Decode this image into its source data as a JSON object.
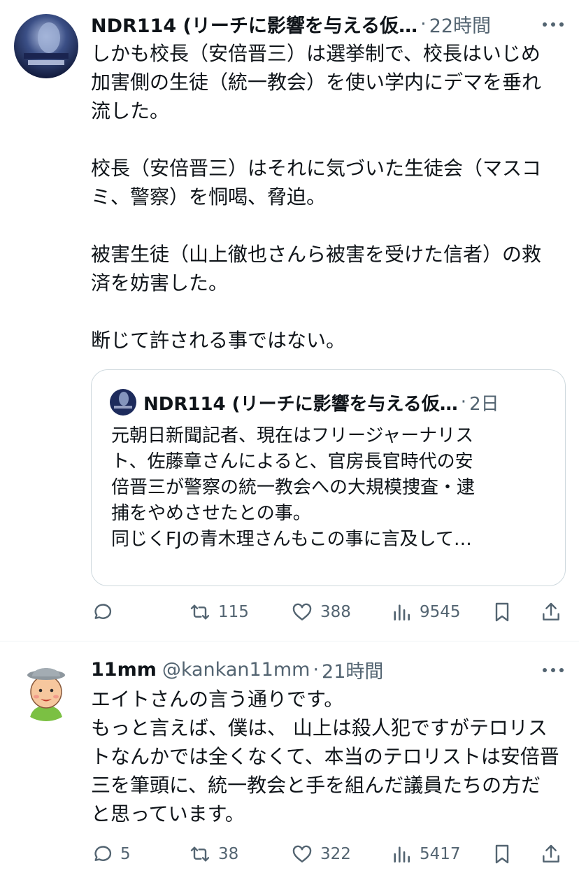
{
  "tweets": [
    {
      "name": "NDR114 (リーチに影響を与える仮…",
      "handle": "",
      "time": "22時間",
      "body": [
        "しかも校長（安倍晋三）は選挙制で、校長はいじめ加害側の生徒（統一教会）を使い学内にデマを垂れ流した。",
        "",
        "校長（安倍晋三）はそれに気づいた生徒会（マスコミ、警察）を恫喝、脅迫。",
        "",
        "被害生徒（山上徹也さんら被害を受けた信者）の救済を妨害した。",
        "",
        "断じて許される事ではない。"
      ],
      "quote": {
        "name": "NDR114 (リーチに影響を与える仮…",
        "time": "2日",
        "lines": [
          "元朝日新聞記者、現在はフリージャーナリス",
          "ト、佐藤章さんによると、官房長官時代の安",
          "倍晋三が警察の統一教会への大規模捜査・逮",
          "捕をやめさせたとの事。",
          "同じくFJの青木理さんもこの事に言及して…"
        ]
      },
      "metrics": {
        "replies": "",
        "retweets": "115",
        "likes": "388",
        "views": "9545"
      }
    },
    {
      "name": "11mm",
      "handle": "@kankan11mm",
      "time": "21時間",
      "body": [
        "エイトさんの言う通りです。",
        "もっと言えば、僕は、 山上は殺人犯ですがテロリストなんかでは全くなくて、本当のテロリストは安倍晋三を筆頭に、統一教会と手を組んだ議員たちの方だと思っています。"
      ],
      "metrics": {
        "replies": "5",
        "retweets": "38",
        "likes": "322",
        "views": "5417"
      }
    }
  ],
  "colors": {
    "text": "#0f1419",
    "secondary": "#536471",
    "border": "#cfd9de",
    "divider": "#eff3f4"
  },
  "icons": [
    "more-icon",
    "reply-icon",
    "retweet-icon",
    "like-icon",
    "views-icon",
    "bookmark-icon",
    "share-icon"
  ]
}
